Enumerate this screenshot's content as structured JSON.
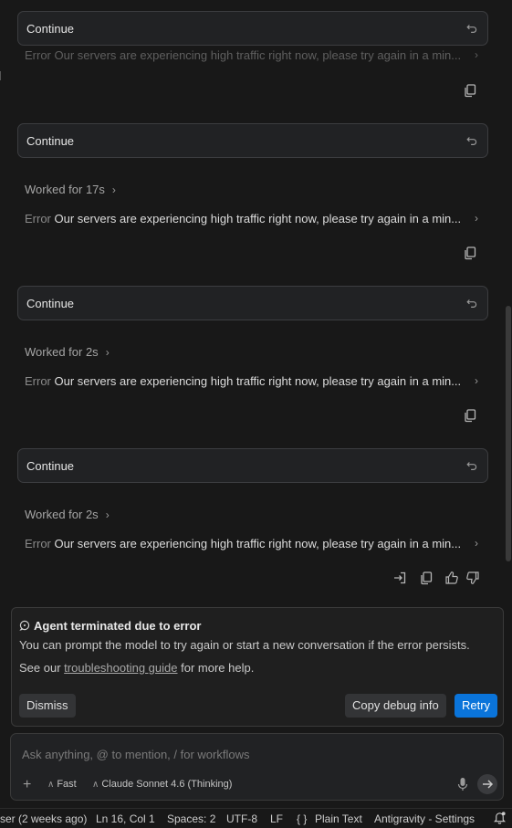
{
  "chat": {
    "messages": [
      {
        "prompt": "Continue"
      },
      {
        "prompt": "Continue",
        "worked": "Worked for 17s"
      },
      {
        "prompt": "Continue",
        "worked": "Worked for 2s"
      },
      {
        "prompt": "Continue",
        "worked": "Worked for 2s"
      }
    ],
    "error_label": "Error",
    "error_text": "Our servers are experiencing high traffic right now, please try again in a min..."
  },
  "agent_panel": {
    "title": "Agent terminated due to error",
    "body": "You can prompt the model to try again or start a new conversation if the error persists.",
    "see_prefix": "See our",
    "link_text": "troubleshooting guide",
    "see_suffix": "for more help.",
    "dismiss_label": "Dismiss",
    "debug_label": "Copy debug info",
    "retry_label": "Retry"
  },
  "input": {
    "placeholder": "Ask anything, @ to mention, / for workflows",
    "mode_label": "Fast",
    "model_label": "Claude Sonnet 4.6 (Thinking)"
  },
  "status_bar": {
    "git": "ser (2 weeks ago)",
    "cursor": "Ln 16, Col 1",
    "spaces": "Spaces: 2",
    "encoding": "UTF-8",
    "eol": "LF",
    "language_icon": "{ }",
    "language": "Plain Text",
    "settings": "Antigravity - Settings"
  },
  "colors": {
    "accent": "#0a74da",
    "panel": "#212224",
    "background": "#181818"
  }
}
